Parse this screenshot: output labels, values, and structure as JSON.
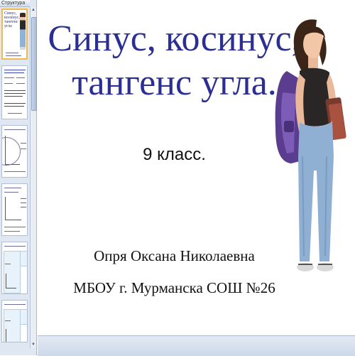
{
  "pane": {
    "tab_label": "Структура",
    "thumb1_title": "Синус, косинус, тангенс угла"
  },
  "slide": {
    "title_line1": "Синус, косинус,",
    "title_line2": "тангенс угла.",
    "subtitle": "9 класс.",
    "author": "Опря Оксана Николаевна",
    "school": "МБОУ г. Мурманска СОШ №26"
  },
  "colors": {
    "title": "#2b2e93",
    "pane_bg": "#dfe7f2",
    "selected_border": "#f2b84b"
  },
  "icons": {
    "girl_image": "schoolgirl-with-backpack-image",
    "scroll_up": "scroll-up-arrow-icon"
  }
}
